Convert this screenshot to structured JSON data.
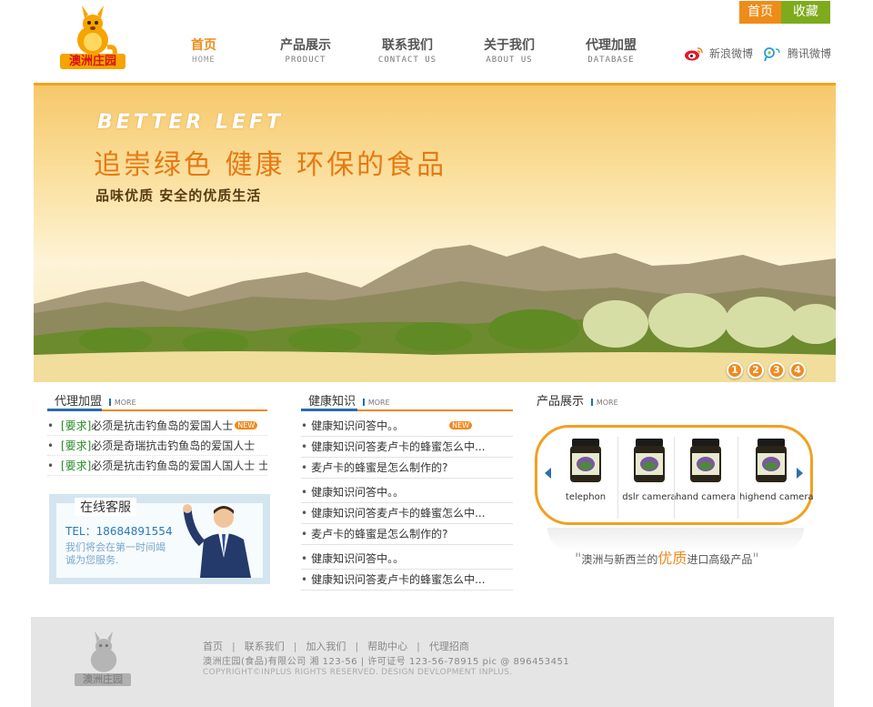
{
  "top_buttons": {
    "home": "首页",
    "favorite": "收藏"
  },
  "logo": {
    "text": "澳洲庄园"
  },
  "nav": [
    {
      "cn": "首页",
      "en": "HOME"
    },
    {
      "cn": "产品展示",
      "en": "PRODUCT"
    },
    {
      "cn": "联系我们",
      "en": "CONTACT US"
    },
    {
      "cn": "关于我们",
      "en": "ABOUT US"
    },
    {
      "cn": "代理加盟",
      "en": "DATABASE"
    }
  ],
  "social": {
    "sina": "新浪微博",
    "tencent": "腾讯微博"
  },
  "banner": {
    "en_title": "BETTER LEFT",
    "cn_title": "追崇绿色 健康 环保的食品",
    "subtitle": "品味优质 安全的优质生活",
    "pages": [
      "1",
      "2",
      "3",
      "4"
    ]
  },
  "agency": {
    "title": "代理加盟",
    "more": "MORE",
    "items": [
      {
        "tag": "[要求]",
        "text": "必须是抗击钓鱼岛的爱国人士",
        "badge": "NEW"
      },
      {
        "tag": "[要求]",
        "text": "必须是奇瑞抗击钓鱼岛的爱国人士",
        "badge": ""
      },
      {
        "tag": "[要求]",
        "text": "必须是抗击钓鱼岛的爱国人国人士 士",
        "badge": ""
      }
    ]
  },
  "service": {
    "title": "在线客服",
    "phone": "TEL：18684891554",
    "note": "我们将会在第一时间竭诚为您服务."
  },
  "health": {
    "title": "健康知识",
    "more": "MORE",
    "items": [
      {
        "text": "健康知识问答中。。",
        "badge": "NEW"
      },
      {
        "text": "健康知识问答麦卢卡的蜂蜜怎么中...",
        "badge": ""
      },
      {
        "text": "麦卢卡的蜂蜜是怎么制作的?",
        "badge": ""
      },
      {
        "text": "健康知识问答中。。",
        "badge": ""
      },
      {
        "text": "健康知识问答麦卢卡的蜂蜜怎么中...",
        "badge": ""
      },
      {
        "text": "麦卢卡的蜂蜜是怎么制作的?",
        "badge": ""
      },
      {
        "text": "健康知识问答中。。",
        "badge": ""
      },
      {
        "text": "健康知识问答麦卢卡的蜂蜜怎么中...",
        "badge": ""
      }
    ]
  },
  "products": {
    "title": "产品展示",
    "more": "MORE",
    "items": [
      "telephon",
      "dslr camera",
      "hand camera",
      "highend camera"
    ],
    "slogan_pre": "澳洲与新西兰的",
    "slogan_hl": "优质",
    "slogan_post": "进口高级产品",
    "quote_open": "\"",
    "quote_close": "\""
  },
  "footer": {
    "logo_text": "澳洲庄园",
    "links": [
      "首页",
      "联系我们",
      "加入我们",
      "帮助中心",
      "代理招商"
    ],
    "separator": "|",
    "info": "澳洲庄园(食品)有限公司 湘 123-56 | 许可证号 123-56-78915 pic @ 896453451",
    "copyright": "COPYRIGHT©INPLUS RIGHTS RESERVED. DESIGN DEVLOPMENT INPLUS."
  },
  "colors": {
    "accent": "#f08a1e",
    "green": "#7eab1c",
    "blue": "#2a6bb0"
  }
}
